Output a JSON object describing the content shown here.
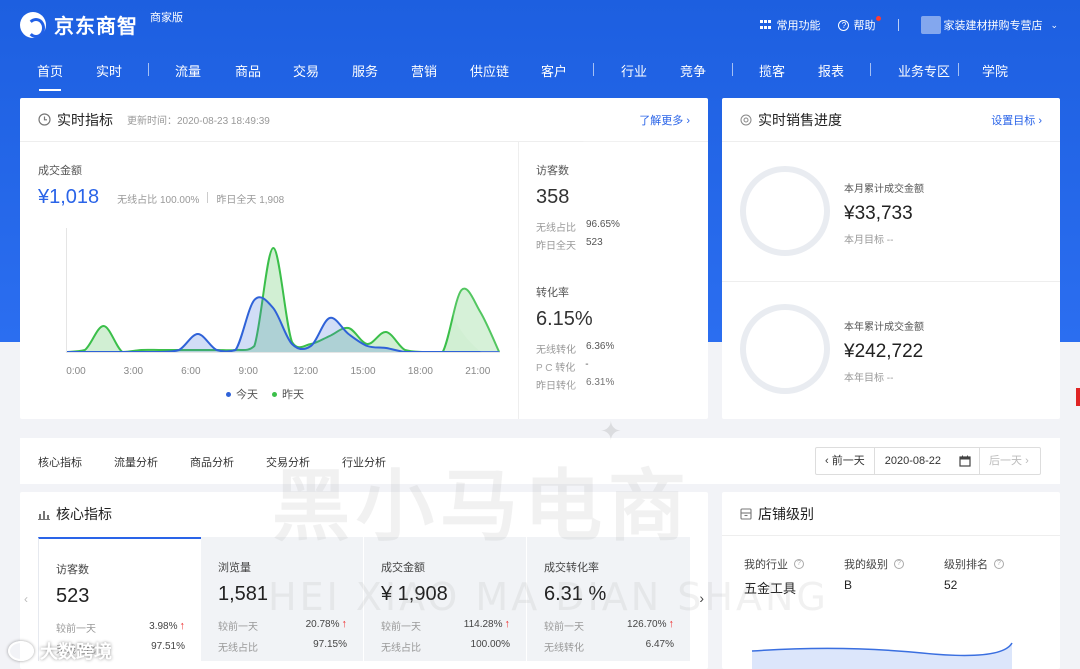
{
  "header": {
    "brand": "京东商智",
    "brand_badge": "商家版",
    "common_functions": "常用功能",
    "help": "帮助",
    "shop_name": "家装建材拼购专营店"
  },
  "nav": {
    "tabs": [
      "首页",
      "实时",
      "流量",
      "商品",
      "交易",
      "服务",
      "营销",
      "供应链",
      "客户",
      "行业",
      "竞争",
      "揽客",
      "报表",
      "业务专区",
      "学院"
    ]
  },
  "realtime": {
    "title": "实时指标",
    "updated": "更新时间：2020-08-23 18:49:39",
    "learn_more": "了解更多",
    "gmv_label": "成交金额",
    "gmv_value": "¥1,018",
    "gmv_wireless": "无线占比 100.00%",
    "gmv_yesterday": "昨日全天 1,908",
    "visitors_label": "访客数",
    "visitors_value": "358",
    "visitors_wireless_label": "无线占比",
    "visitors_wireless_value": "96.65%",
    "visitors_yesterday_label": "昨日全天",
    "visitors_yesterday_value": "523",
    "conv_label": "转化率",
    "conv_value": "6.15%",
    "conv_wireless_label": "无线转化",
    "conv_wireless_value": "6.36%",
    "conv_pc_label": "P C 转化",
    "conv_pc_value": "-",
    "conv_yesterday_label": "昨日转化",
    "conv_yesterday_value": "6.31%"
  },
  "chart_data": {
    "type": "area",
    "x_ticks": [
      "0:00",
      "3:00",
      "6:00",
      "9:00",
      "12:00",
      "15:00",
      "18:00",
      "21:00"
    ],
    "x": [
      0,
      1,
      2,
      3,
      4,
      5,
      6,
      7,
      8,
      9,
      10,
      11,
      12,
      13,
      14,
      15,
      16,
      17,
      18,
      19,
      20,
      21,
      22,
      23
    ],
    "series": [
      {
        "name": "今天",
        "color": "#2f62d8",
        "values": [
          0,
          0,
          0,
          0,
          0,
          0,
          0.1,
          0.9,
          0.1,
          0.1,
          2.6,
          2.2,
          0.4,
          0.3,
          1.7,
          0.9,
          0.3,
          0.2,
          0.0,
          0,
          0,
          0,
          0,
          0
        ]
      },
      {
        "name": "昨天",
        "color": "#3bbf4a",
        "values": [
          0,
          0.1,
          1.3,
          0.0,
          0.1,
          0.1,
          0.1,
          0.1,
          0.1,
          0.1,
          0.3,
          5.2,
          0.5,
          0.4,
          0.8,
          1.2,
          0.4,
          1.0,
          0.1,
          0.0,
          0.0,
          3.1,
          2.0,
          0.0
        ]
      }
    ],
    "ylim": [
      0,
      6
    ]
  },
  "sales_progress": {
    "title": "实时销售进度",
    "set_goal": "设置目标",
    "month_label": "本月累计成交金额",
    "month_value": "¥33,733",
    "month_target": "本月目标 --",
    "year_label": "本年累计成交金额",
    "year_value": "¥242,722",
    "year_target": "本年目标 --"
  },
  "subtabs": {
    "items": [
      "核心指标",
      "流量分析",
      "商品分析",
      "交易分析",
      "行业分析"
    ],
    "prev_day": "前一天",
    "date": "2020-08-22",
    "next_day": "后一天"
  },
  "core": {
    "title": "核心指标",
    "cards": [
      {
        "label": "访客数",
        "value": "523",
        "r1k": "较前一天",
        "r1v": "3.98%",
        "r2k": "无线占比",
        "r2v": "97.51%"
      },
      {
        "label": "浏览量",
        "value": "1,581",
        "r1k": "较前一天",
        "r1v": "20.78%",
        "r2k": "无线占比",
        "r2v": "97.15%"
      },
      {
        "label": "成交金额",
        "value": "¥ 1,908",
        "r1k": "较前一天",
        "r1v": "114.28%",
        "r2k": "无线占比",
        "r2v": "100.00%"
      },
      {
        "label": "成交转化率",
        "value": "6.31 %",
        "r1k": "较前一天",
        "r1v": "126.70%",
        "r2k": "无线转化",
        "r2v": "6.47%"
      }
    ]
  },
  "store_level": {
    "title": "店铺级别",
    "industry_label": "我的行业",
    "industry_value": "五金工具",
    "level_label": "我的级别",
    "level_value": "B",
    "rank_label": "级别排名",
    "rank_value": "52"
  },
  "watermark": {
    "cn": "黑小马电商",
    "en": "HEI XIAO MA DIAN SHANG",
    "corner": "大数跨境"
  }
}
